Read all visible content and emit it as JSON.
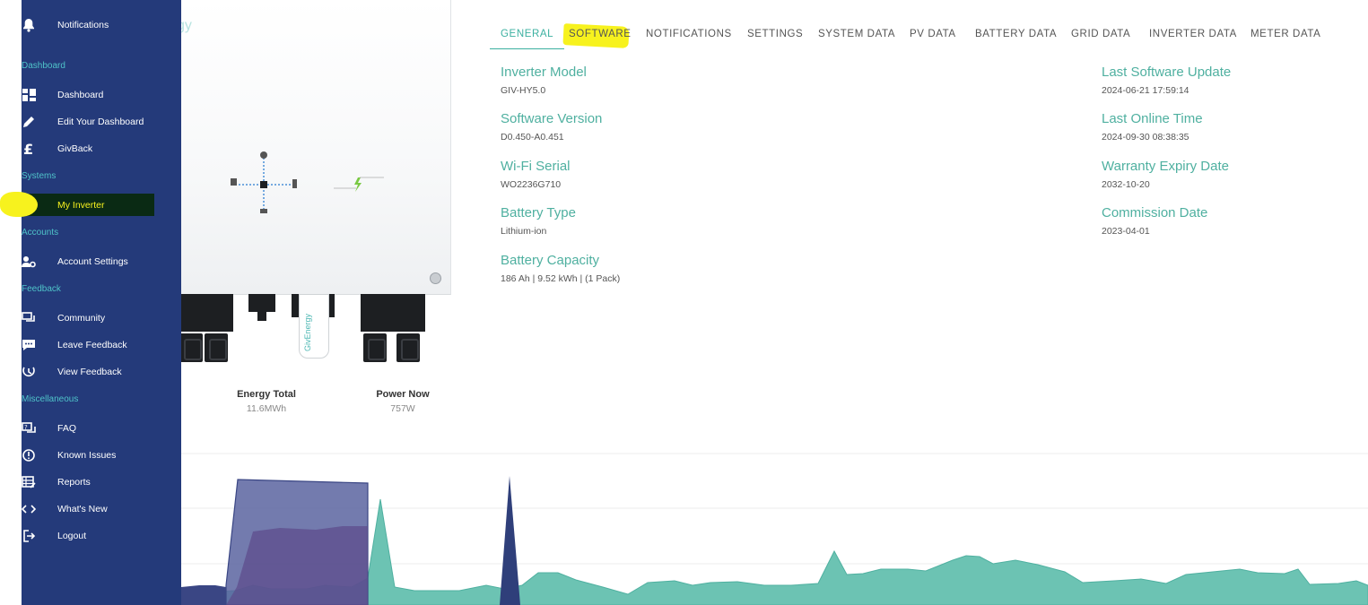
{
  "sidebar": {
    "items": [
      {
        "label": "Notifications",
        "icon": "bell-icon"
      },
      {
        "label": "Dashboard",
        "icon": "dashboard-icon"
      },
      {
        "label": "Edit Your Dashboard",
        "icon": "pencil-icon"
      },
      {
        "label": "GivBack",
        "icon": "pound-icon"
      },
      {
        "label": "My Inverter",
        "icon": "monitor-icon"
      },
      {
        "label": "Account Settings",
        "icon": "user-gear-icon"
      },
      {
        "label": "Community",
        "icon": "chat-icon"
      },
      {
        "label": "Leave Feedback",
        "icon": "feedback-icon"
      },
      {
        "label": "View Feedback",
        "icon": "feedback-view-icon"
      },
      {
        "label": "FAQ",
        "icon": "faq-icon"
      },
      {
        "label": "Known Issues",
        "icon": "alert-circle-icon"
      },
      {
        "label": "Reports",
        "icon": "report-icon"
      },
      {
        "label": "What's New",
        "icon": "code-icon"
      },
      {
        "label": "Logout",
        "icon": "logout-icon"
      }
    ],
    "sections": [
      "Dashboard",
      "Systems",
      "Accounts",
      "Feedback",
      "Miscellaneous"
    ]
  },
  "device": {
    "brand_partial": "gy",
    "dongle_text": "GivEnergy",
    "stats": [
      {
        "title": "Energy Total",
        "value": "11.6MWh"
      },
      {
        "title": "Power Now",
        "value": "757W"
      }
    ]
  },
  "tabs": [
    "GENERAL",
    "SOFTWARE",
    "NOTIFICATIONS",
    "SETTINGS",
    "SYSTEM DATA",
    "PV DATA",
    "BATTERY DATA",
    "GRID DATA",
    "INVERTER DATA",
    "METER DATA"
  ],
  "details_left": [
    {
      "label": "Inverter Model",
      "value": "GIV-HY5.0"
    },
    {
      "label": "Software Version",
      "value": "D0.450-A0.451"
    },
    {
      "label": "Wi-Fi Serial",
      "value": "WO2236G710"
    },
    {
      "label": "Battery Type",
      "value": "Lithium-ion"
    },
    {
      "label": "Battery Capacity",
      "value": "186 Ah | 9.52 kWh | (1 Pack)"
    }
  ],
  "details_right": [
    {
      "label": "Last Software Update",
      "value": "2024-06-21 17:59:14"
    },
    {
      "label": "Last Online Time",
      "value": "2024-09-30 08:38:35"
    },
    {
      "label": "Warranty Expiry Date",
      "value": "2032-10-20"
    },
    {
      "label": "Commission Date",
      "value": "2023-04-01"
    }
  ],
  "colors": {
    "sidebar_bg": "#243a7a",
    "accent": "#4fb0a0",
    "section": "#4fc3c9",
    "highlight": "#f7f21e"
  }
}
